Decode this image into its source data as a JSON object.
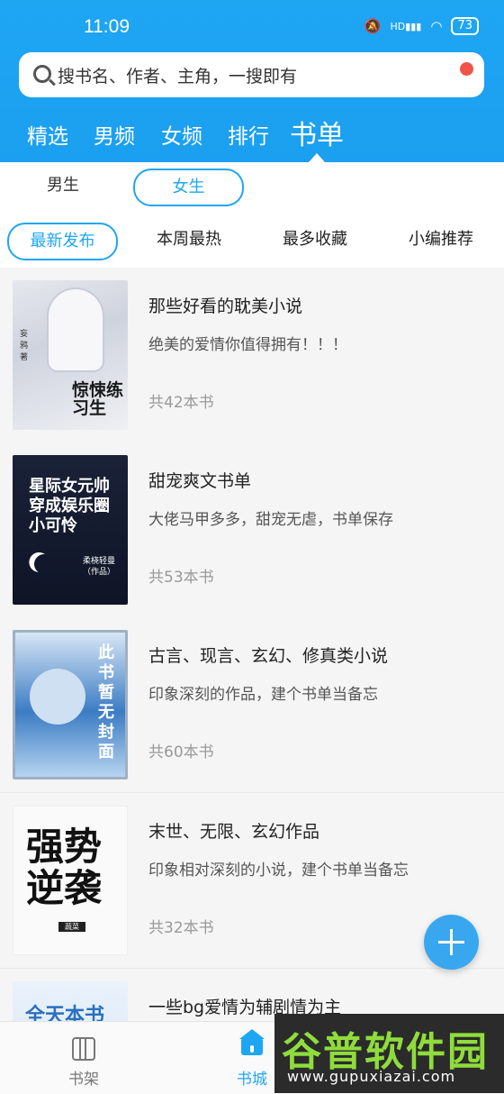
{
  "status_bar": {
    "time": "11:09",
    "network": "HD",
    "battery": "73"
  },
  "search": {
    "placeholder": "搜书名、作者、主角，一搜即有"
  },
  "tabs": [
    {
      "label": "精选"
    },
    {
      "label": "男频"
    },
    {
      "label": "女频"
    },
    {
      "label": "排行"
    },
    {
      "label": "书单",
      "active": true
    }
  ],
  "gender_filter": {
    "options": [
      "男生",
      "女生"
    ],
    "selected": "女生"
  },
  "sort_filter": {
    "options": [
      "最新发布",
      "本周最热",
      "最多收藏",
      "小编推荐"
    ],
    "selected": "最新发布"
  },
  "book_lists": [
    {
      "title": "那些好看的耽美小说",
      "desc": "绝美的爱情你值得拥有！！！",
      "count": "共42本书",
      "cover_text": "惊悚练习生",
      "cover_author": "妄鸦 著"
    },
    {
      "title": "甜宠爽文书单",
      "desc": "大佬马甲多多，甜宠无虐，书单保存",
      "count": "共53本书",
      "cover_text": "星际女元帅穿成娱乐圈小可怜",
      "cover_author": "柔桡轻曼（作品）"
    },
    {
      "title": "古言、现言、玄幻、修真类小说",
      "desc": "印象深刻的作品，建个书单当备忘",
      "count": "共60本书",
      "cover_text": "此书暂无封面"
    },
    {
      "title": "末世、无限、玄幻作品",
      "desc": "印象相对深刻的小说，建个书单当备忘",
      "count": "共32本书",
      "cover_text": "强势逆袭",
      "cover_author": "蔬菜"
    },
    {
      "title": "一些bg爱情为辅剧情为主",
      "desc": "",
      "count": "",
      "cover_text": "全天本书"
    }
  ],
  "bottom_nav": [
    {
      "label": "书架",
      "icon": "bookshelf-icon"
    },
    {
      "label": "书城",
      "icon": "home-icon",
      "active": true
    }
  ],
  "watermark": {
    "brand": "谷普软件园",
    "url": "www.gupuxiazai.com"
  },
  "colors": {
    "accent": "#1ea6f3",
    "red_dot": "#f0534a"
  }
}
